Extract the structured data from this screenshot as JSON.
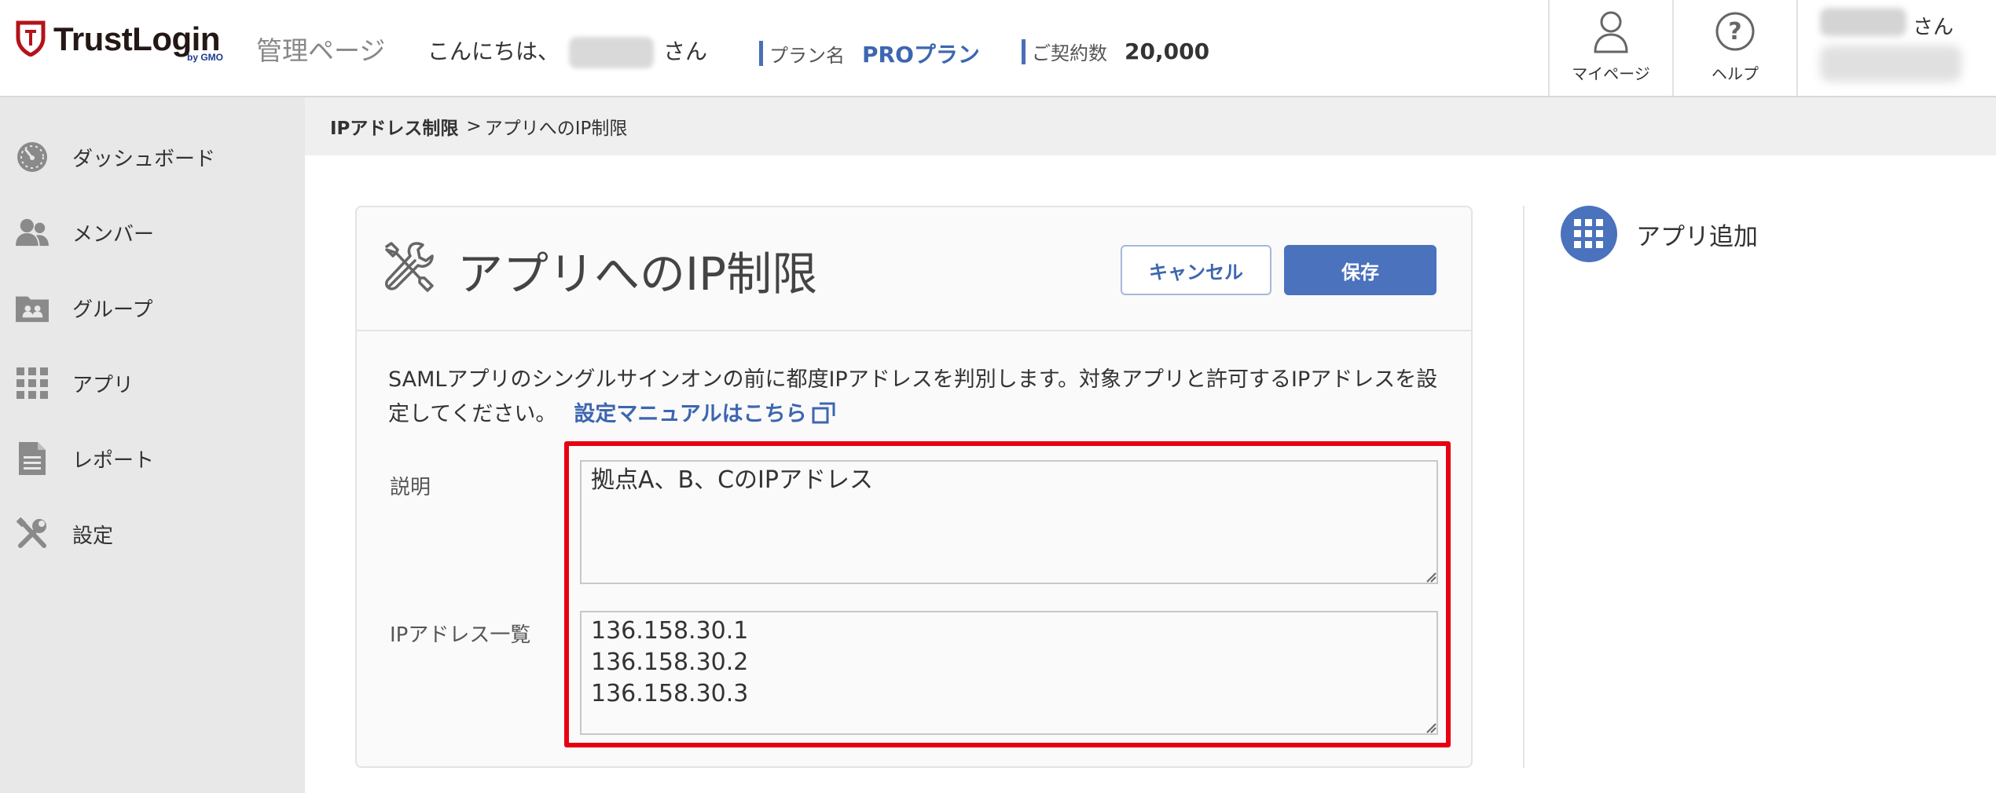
{
  "header": {
    "logo_text": "TrustLogin",
    "logo_sub": "by GMO",
    "admin_title": "管理ページ",
    "greeting_prefix": "こんにちは、",
    "greeting_suffix": "さん",
    "plan_label": "プラン名",
    "plan_value": "PROプラン",
    "contract_label": "ご契約数",
    "contract_value": "20,000",
    "mypage_label": "マイページ",
    "help_label": "ヘルプ",
    "user_suffix": "さん"
  },
  "sidebar": {
    "items": [
      {
        "label": "ダッシュボード",
        "icon": "dashboard-gauge-icon"
      },
      {
        "label": "メンバー",
        "icon": "members-icon"
      },
      {
        "label": "グループ",
        "icon": "group-folder-icon"
      },
      {
        "label": "アプリ",
        "icon": "app-grid-icon"
      },
      {
        "label": "レポート",
        "icon": "report-document-icon"
      },
      {
        "label": "設定",
        "icon": "tools-icon"
      }
    ]
  },
  "breadcrumb": {
    "parent": "IPアドレス制限",
    "separator": ">",
    "current": "アプリへのIP制限"
  },
  "card": {
    "title": "アプリへのIP制限",
    "cancel_label": "キャンセル",
    "save_label": "保存",
    "description": "SAMLアプリのシングルサインオンの前に都度IPアドレスを判別します。対象アプリと許可するIPアドレスを設定してください。",
    "manual_link": "設定マニュアルはこちら",
    "description_field_label": "説明",
    "description_value": "拠点A、B、CのIPアドレス",
    "ip_field_label": "IPアドレス一覧",
    "ip_list": [
      "136.158.30.1",
      "136.158.30.2",
      "136.158.30.3"
    ]
  },
  "right_panel": {
    "add_app_label": "アプリ追加"
  },
  "colors": {
    "accent_blue": "#4a72bd",
    "link_blue": "#3d66b0",
    "highlight_red": "#e60012",
    "logo_red": "#b5121b"
  }
}
